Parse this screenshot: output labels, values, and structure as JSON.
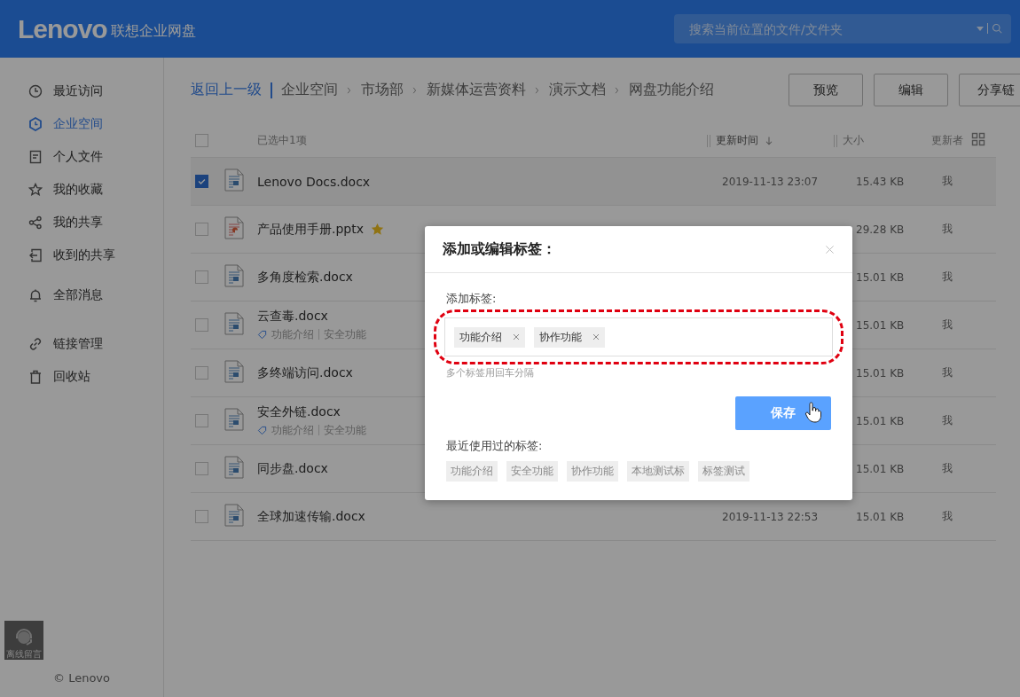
{
  "header": {
    "logo": "Lenovo",
    "product": "联想企业网盘",
    "search": {
      "placeholder": "搜索当前位置的文件/文件夹"
    }
  },
  "sidebar": {
    "groups": [
      [
        {
          "label": "最近访问",
          "selected": false
        },
        {
          "label": "企业空间",
          "selected": true
        },
        {
          "label": "个人文件",
          "selected": false
        },
        {
          "label": "我的收藏",
          "selected": false
        },
        {
          "label": "我的共享",
          "selected": false
        },
        {
          "label": "收到的共享",
          "selected": false
        }
      ],
      [
        {
          "label": "全部消息",
          "selected": false
        }
      ],
      [
        {
          "label": "链接管理",
          "selected": false
        },
        {
          "label": "回收站",
          "selected": false
        }
      ]
    ],
    "support": "离线留言",
    "footer": "© Lenovo"
  },
  "breadcrumb": {
    "back": "返回上一级",
    "path": [
      "企业空间",
      "市场部",
      "新媒体运营资料",
      "演示文档",
      "网盘功能介绍"
    ]
  },
  "actions": [
    "预览",
    "编辑",
    "分享链"
  ],
  "table": {
    "all_checked": false,
    "columns": [
      {
        "label": "已选中1项",
        "sorted": false
      },
      {
        "label": "更新时间",
        "sorted": true
      },
      {
        "label": "大小",
        "sorted": false
      },
      {
        "label": "更新者",
        "sorted": false
      }
    ],
    "rows": [
      {
        "kind": "docx",
        "name": "Lenovo Docs.docx",
        "checked": true,
        "starred": false,
        "updated": "2019-11-13 23:07",
        "size": "15.43 KB",
        "updater": "我"
      },
      {
        "kind": "pptx",
        "name": "产品使用手册.pptx",
        "checked": false,
        "starred": true,
        "size": "29.28 KB",
        "updater": "我"
      },
      {
        "kind": "docx",
        "name": "多角度检索.docx",
        "checked": false,
        "starred": false,
        "size": "15.01 KB",
        "updater": "我"
      },
      {
        "kind": "docx",
        "name": "云查毒.docx",
        "checked": false,
        "starred": false,
        "tags": [
          "功能介绍",
          "安全功能"
        ],
        "size": "15.01 KB",
        "updater": "我"
      },
      {
        "kind": "docx",
        "name": "多终端访问.docx",
        "checked": false,
        "starred": false,
        "size": "15.01 KB",
        "updater": "我"
      },
      {
        "kind": "docx",
        "name": "安全外链.docx",
        "checked": false,
        "starred": false,
        "tags": [
          "功能介绍",
          "安全功能"
        ],
        "size": "15.01 KB",
        "updater": "我"
      },
      {
        "kind": "docx",
        "name": "同步盘.docx",
        "checked": false,
        "starred": false,
        "size": "15.01 KB",
        "updater": "我"
      },
      {
        "kind": "docx",
        "name": "全球加速传输.docx",
        "checked": false,
        "starred": false,
        "updated": "2019-11-13 22:53",
        "size": "15.01 KB",
        "updater": "我"
      }
    ]
  },
  "dialog": {
    "title": "添加或编辑标签：",
    "field_label": "添加标签:",
    "tags": [
      "功能介绍",
      "协作功能"
    ],
    "hint": "多个标签用回车分隔",
    "save": "保存",
    "recent_label": "最近使用过的标签:",
    "recent_tags": [
      "功能介绍",
      "安全功能",
      "协作功能",
      "本地测试标",
      "标签测试"
    ]
  }
}
